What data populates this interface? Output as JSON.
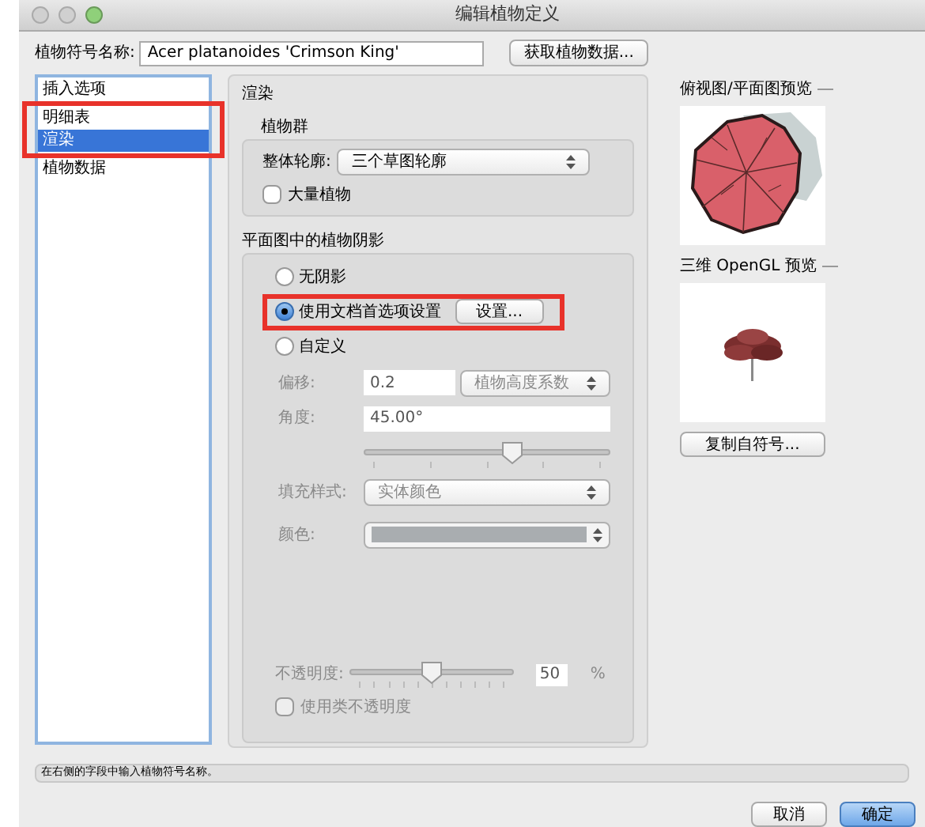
{
  "window": {
    "title": "编辑植物定义"
  },
  "symbol_name": {
    "label": "植物符号名称:",
    "value": "Acer platanoides 'Crimson King'"
  },
  "get_data_button": "获取植物数据...",
  "categories": [
    {
      "label": "插入选项",
      "selected": false,
      "highlighted": false
    },
    {
      "label": "明细表",
      "selected": false,
      "highlighted": true
    },
    {
      "label": "渲染",
      "selected": true,
      "highlighted": true
    },
    {
      "label": "植物数据",
      "selected": false,
      "highlighted": false
    }
  ],
  "panel": {
    "title": "渲染",
    "plant_group": {
      "title": "植物群",
      "outline": {
        "label": "整体轮廓:",
        "value": "三个草图轮廓"
      },
      "mass_planting": {
        "label": "大量植物",
        "checked": false
      }
    },
    "shadow": {
      "title": "平面图中的植物阴影",
      "options": [
        {
          "label": "无阴影",
          "selected": false,
          "highlighted": false
        },
        {
          "label": "使用文档首选项设置",
          "selected": true,
          "highlighted": true
        },
        {
          "label": "自定义",
          "selected": false,
          "highlighted": false
        }
      ],
      "settings_button": "设置...",
      "custom_disabled": true,
      "offset": {
        "label": "偏移:",
        "value": "0.2",
        "unit": "植物高度系数"
      },
      "angle": {
        "label": "角度:",
        "value": "45.00°",
        "level": 0.6
      },
      "fill_style": {
        "label": "填充样式:",
        "value": "实体颜色"
      },
      "color": {
        "label": "颜色:"
      },
      "opacity": {
        "label": "不透明度:",
        "level": 0.5,
        "value": "50",
        "unit": "%"
      },
      "class_opacity": {
        "label": "使用类不透明度",
        "checked": false
      }
    }
  },
  "previews": [
    {
      "title": "俯视图/平面图预览",
      "kind": "top"
    },
    {
      "title": "三维 OpenGL 预览",
      "kind": "tree3d"
    }
  ],
  "copy_button": "复制自符号...",
  "status": "在右侧的字段中输入植物符号名称。",
  "buttons": [
    {
      "label": "取消",
      "default": false
    },
    {
      "label": "确定",
      "default": true
    }
  ]
}
